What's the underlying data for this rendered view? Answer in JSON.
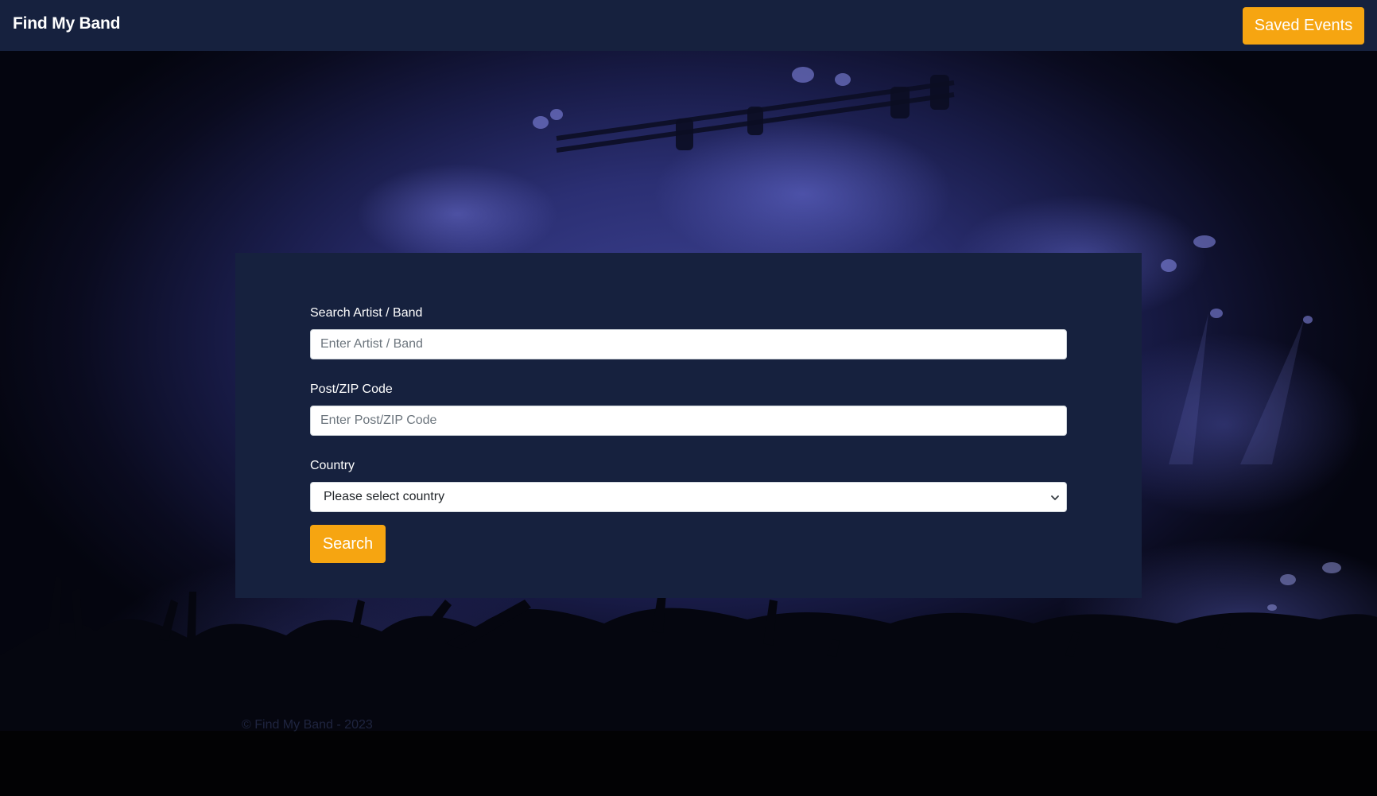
{
  "navbar": {
    "brand": "Find My Band",
    "saved_events_label": "Saved Events"
  },
  "colors": {
    "navbar_bg": "#16213e",
    "card_bg": "#16213e",
    "accent": "#f6a511"
  },
  "search_form": {
    "artist": {
      "label": "Search Artist / Band",
      "placeholder": "Enter Artist / Band",
      "value": ""
    },
    "postcode": {
      "label": "Post/ZIP Code",
      "placeholder": "Enter Post/ZIP Code",
      "value": ""
    },
    "country": {
      "label": "Country",
      "selected": "Please select country"
    },
    "submit_label": "Search"
  },
  "footer": {
    "text": "© Find My Band - 2023"
  },
  "icons": {
    "select_chevron": "chevron-down-icon"
  }
}
